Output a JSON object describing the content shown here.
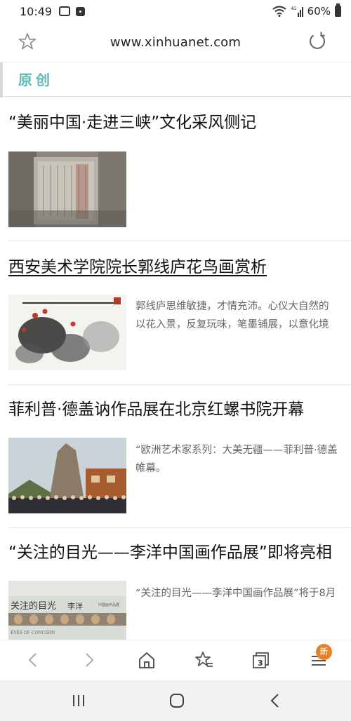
{
  "status_bar": {
    "time": "10:49",
    "left_icons": [
      "vr-icon",
      "photo-icon"
    ],
    "right_icons": [
      "wifi-icon",
      "4g-signal-icon",
      "battery-icon"
    ],
    "battery_percent": "60%"
  },
  "url_bar": {
    "url": "www.xinhuanet.com"
  },
  "section": {
    "title": "原创",
    "accent_color": "#5eb8b3"
  },
  "articles": [
    {
      "title": "“美丽中国·走进三峡”文化采风侧记",
      "excerpt": ""
    },
    {
      "title": "西安美术学院院长郭线庐花鸟画赏析",
      "excerpt_lines": [
        "郭线庐思维敏捷，才情充沛。心仪大自然的",
        "以花入景，反复玩味，笔墨铺展，以意化境"
      ]
    },
    {
      "title": "菲利普·德盖讷作品展在北京红螺书院开幕",
      "excerpt_lines": [
        "“欧洲艺术家系列：大美无疆——菲利普·德盖",
        "帷幕。"
      ]
    },
    {
      "title": "“关注的目光——李洋中国画作品展”即将亮相",
      "excerpt_lines": [
        "“关注的目光——李洋中国画作品展”将于8月"
      ],
      "thumb_text": {
        "main": "关注的目光",
        "author": "李洋",
        "sub": "中国画作品展",
        "en": "EYES OF CONCERN"
      }
    }
  ],
  "bottom_toolbar": {
    "badge": "新",
    "badge_color": "#e8802a",
    "tab_count": "3",
    "items": [
      "back-icon",
      "forward-icon",
      "home-icon",
      "bookmarks-icon",
      "tabs-icon",
      "menu-icon"
    ]
  },
  "android_nav": {
    "items": [
      "recents-icon",
      "home-circle-icon",
      "back-chevron-icon"
    ]
  }
}
